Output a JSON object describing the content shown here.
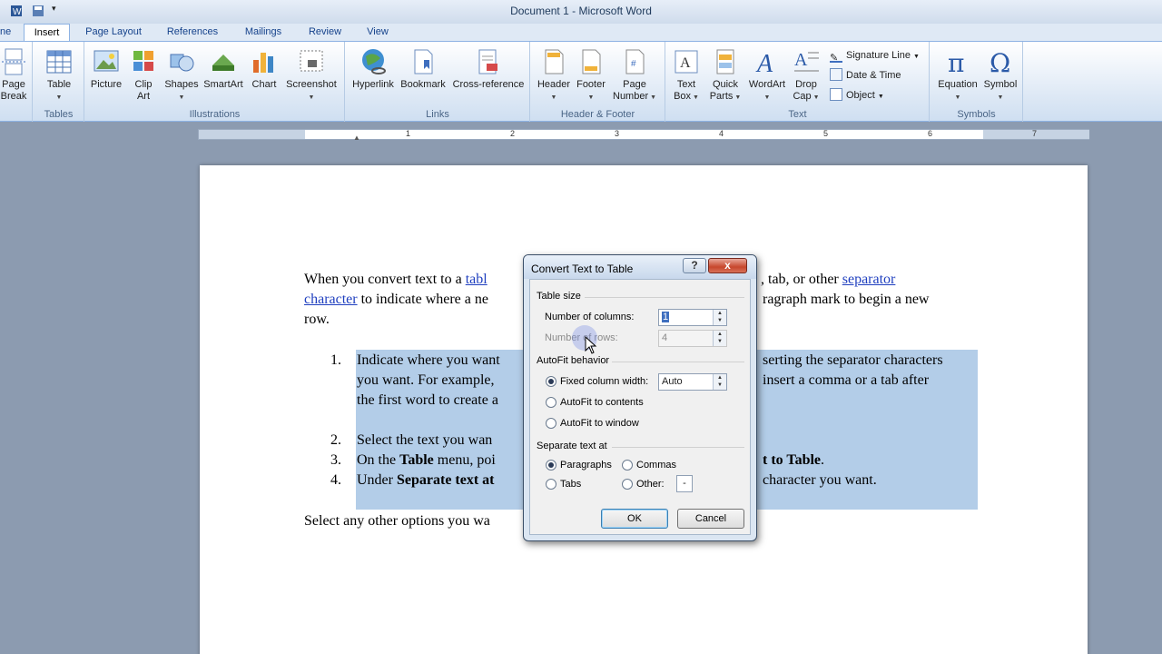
{
  "window": {
    "title": "Document 1  -  Microsoft Word"
  },
  "tabs": [
    "ne",
    "Insert",
    "Page Layout",
    "References",
    "Mailings",
    "Review",
    "View"
  ],
  "ribbon": {
    "groups": {
      "tables": "Tables",
      "illustrations": "Illustrations",
      "links": "Links",
      "header_footer": "Header & Footer",
      "text": "Text",
      "symbols": "Symbols"
    },
    "buttons": {
      "page_break": [
        "Page",
        "Break"
      ],
      "table": "Table",
      "picture": "Picture",
      "clip_art": [
        "Clip",
        "Art"
      ],
      "shapes": "Shapes",
      "smartart": "SmartArt",
      "chart": "Chart",
      "screenshot": "Screenshot",
      "hyperlink": "Hyperlink",
      "bookmark": "Bookmark",
      "cross_reference": "Cross-reference",
      "header": "Header",
      "footer": "Footer",
      "page_number": [
        "Page",
        "Number"
      ],
      "text_box": [
        "Text",
        "Box"
      ],
      "quick_parts": [
        "Quick",
        "Parts"
      ],
      "wordart": "WordArt",
      "drop_cap": [
        "Drop",
        "Cap"
      ],
      "signature_line": "Signature Line",
      "date_time": "Date & Time",
      "object": "Object",
      "equation": "Equation",
      "symbol": "Symbol"
    }
  },
  "ruler": {
    "numbers": [
      "1",
      "1",
      "2",
      "3",
      "4",
      "5",
      "6",
      "7"
    ]
  },
  "document": {
    "intro": {
      "p1_a": "When you convert text to a ",
      "p1_link1": "tabl",
      "p1_b": ", tab, or other ",
      "p1_link2": "separator",
      "p2_link": "character",
      "p2_a": " to indicate where a ne",
      "p2_b": "ragraph mark to begin a new",
      "p3": "row."
    },
    "list": {
      "n1": "1.",
      "i1_a": "Indicate where you want",
      "i1_b": "serting the separator characters",
      "i1_c": "you want. For example,",
      "i1_d": "insert a comma or a tab after",
      "i1_e": "the first word to create a",
      "n2": "2.",
      "i2": "Select the text you wan",
      "n3": "3.",
      "i3_a": "On the ",
      "i3_b": "Table",
      "i3_c": " menu, poi",
      "i3_d": "t to Table",
      "i3_e": ".",
      "n4": "4.",
      "i4_a": "Under ",
      "i4_b": "Separate text at",
      "i4_c": "character you want."
    },
    "outro": "Select any other options you wa"
  },
  "dialog": {
    "title": "Convert Text to Table",
    "help": "?",
    "close": "x",
    "table_size": "Table size",
    "num_columns_label": "Number of columns:",
    "num_columns_value": "1",
    "num_rows_label": "Number of rows:",
    "num_rows_value": "4",
    "autofit_behavior": "AutoFit behavior",
    "fixed_width_label": "Fixed column width:",
    "fixed_width_value": "Auto",
    "autofit_contents": "AutoFit to contents",
    "autofit_window": "AutoFit to window",
    "separate_at": "Separate text at",
    "paragraphs": "Paragraphs",
    "commas": "Commas",
    "tabs": "Tabs",
    "other": "Other:",
    "other_value": "-",
    "ok": "OK",
    "cancel": "Cancel"
  },
  "colors": {
    "accent": "#1f3fbf",
    "selection": "#b3cde8",
    "ribbon": "#dde8f5"
  }
}
